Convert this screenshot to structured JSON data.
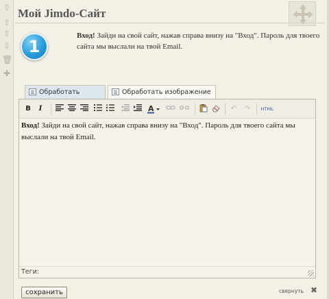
{
  "page": {
    "title": "Мой Jimdo-Сайт"
  },
  "intro": {
    "step_number": "1",
    "lead": "Вход!",
    "text": " Зайди на свой сайт, нажав справа внизу на \"Вход\". Пароль для твоего сайта мы выслали на твой Email."
  },
  "tabs": {
    "text_tab": "Обработать текст",
    "image_tab": "Обработать изображение"
  },
  "toolbar": {
    "bold": "B",
    "italic": "I",
    "html": "HTML"
  },
  "editor": {
    "lead": "Вход!",
    "text": " Зайди на свой сайт, нажав справа внизу на \"Вход\". Пароль для твоего сайта мы выслали на твой Email.",
    "tags_label": "Теги:"
  },
  "actions": {
    "save_label": "сохранить",
    "collapse_label": "свернуть"
  },
  "icons": {
    "left_bar": [
      "arrow-up-icon",
      "arrow-up-icon",
      "arrow-down-icon",
      "arrow-down-icon",
      "trash-icon",
      "plus-icon"
    ],
    "move": "move-arrows-icon"
  },
  "colors": {
    "background": "#f3f0e6",
    "step_circle": "#2a9bd8",
    "active_tab": "#dde8ee"
  }
}
